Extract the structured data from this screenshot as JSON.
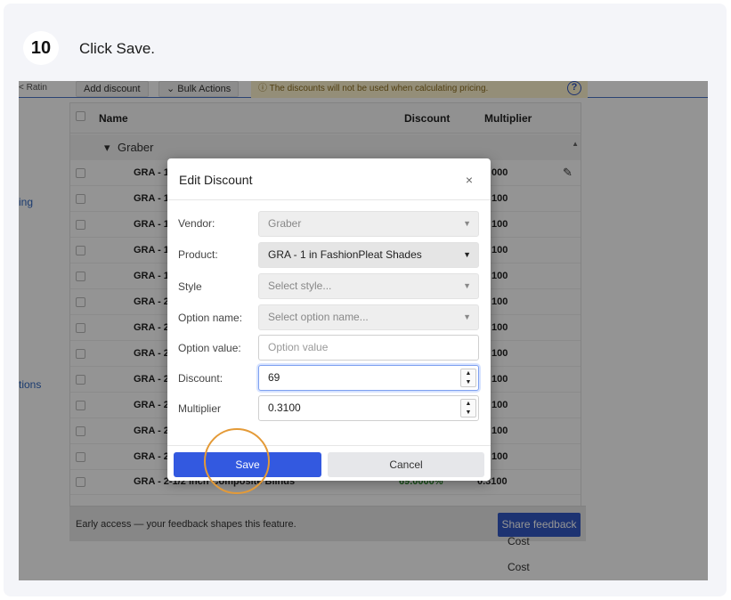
{
  "step": {
    "number": "10",
    "text": "Click Save."
  },
  "toolbar": {
    "back_fragment": "< Ratin",
    "add_discount": "Add discount",
    "bulk_actions": "Bulk Actions",
    "warning": "The discounts will not be used when calculating pricing.",
    "help_glyph": "?"
  },
  "sidebar": {
    "link1": "ing",
    "link2": "tions"
  },
  "table": {
    "headers": {
      "name": "Name",
      "discount": "Discount",
      "multiplier": "Multiplier"
    },
    "group": "Graber",
    "rows": [
      {
        "name": "GRA - 1",
        "multiplier": "000"
      },
      {
        "name": "GRA - 1",
        "multiplier": "100"
      },
      {
        "name": "GRA - 1",
        "multiplier": "100"
      },
      {
        "name": "GRA - 1",
        "multiplier": "100"
      },
      {
        "name": "GRA - 1",
        "multiplier": "100"
      },
      {
        "name": "GRA - 2",
        "multiplier": "100"
      },
      {
        "name": "GRA - 2",
        "multiplier": "100"
      },
      {
        "name": "GRA - 2",
        "multiplier": "100"
      },
      {
        "name": "GRA - 2",
        "multiplier": "100"
      },
      {
        "name": "GRA - 2",
        "multiplier": "100"
      },
      {
        "name": "GRA - 2",
        "multiplier": "100"
      },
      {
        "name": "GRA - 2",
        "multiplier": "100"
      }
    ],
    "last_row": {
      "name": "GRA - 2-1/2 inch Composite Blinds",
      "discount": "69.0000%",
      "multiplier": "0.3100"
    }
  },
  "footer": {
    "text": "Early access — your feedback shapes this feature.",
    "share": "Share feedback",
    "cost1": "Cost",
    "cost2": "Cost"
  },
  "modal": {
    "title": "Edit Discount",
    "close": "×",
    "fields": {
      "vendor_label": "Vendor:",
      "vendor_value": "Graber",
      "product_label": "Product:",
      "product_value": "GRA - 1 in FashionPleat Shades",
      "style_label": "Style",
      "style_placeholder": "Select style...",
      "option_name_label": "Option name:",
      "option_name_placeholder": "Select option name...",
      "option_value_label": "Option value:",
      "option_value_placeholder": "Option value",
      "discount_label": "Discount:",
      "discount_value": "69",
      "multiplier_label": "Multiplier",
      "multiplier_value": "0.3100"
    },
    "save": "Save",
    "cancel": "Cancel"
  },
  "colors": {
    "primary": "#3359e0",
    "highlight_ring": "#e49a37",
    "warning_bg": "#fff5cf"
  }
}
